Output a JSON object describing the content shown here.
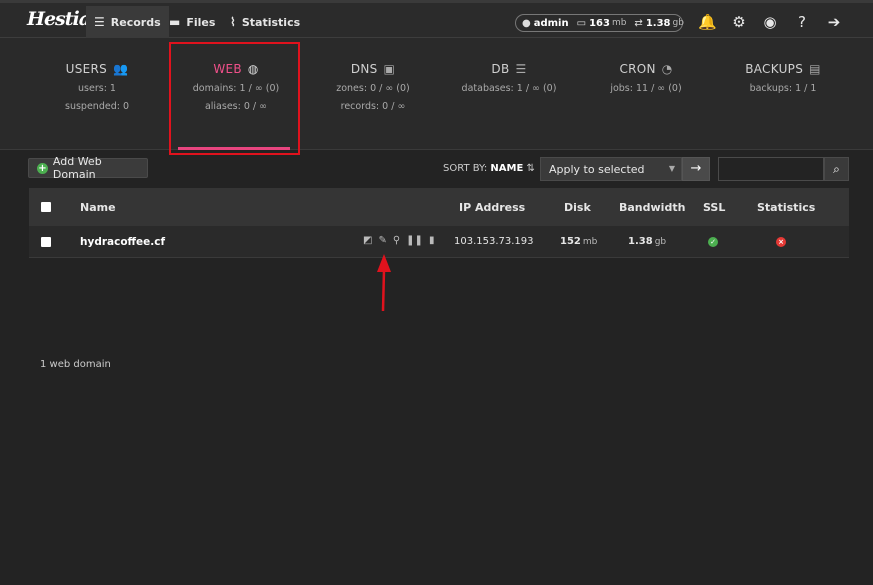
{
  "header": {
    "logo": "Hestia",
    "nav": [
      {
        "label": "Records",
        "icon": "list-icon"
      },
      {
        "label": "Files",
        "icon": "folder-icon"
      },
      {
        "label": "Statistics",
        "icon": "chart-icon"
      }
    ],
    "user": {
      "name": "admin",
      "disk_value": "163",
      "disk_unit": "mb",
      "bandwidth_value": "1.38",
      "bandwidth_unit": "gb"
    }
  },
  "stats": [
    {
      "key": "users",
      "title": "USERS",
      "icon": "users-icon",
      "lines": [
        "users: 1",
        "suspended: 0"
      ]
    },
    {
      "key": "web",
      "title": "WEB",
      "icon": "globe-icon",
      "lines": [
        "domains: 1 / ∞ (0)",
        "aliases: 0 / ∞"
      ]
    },
    {
      "key": "dns",
      "title": "DNS",
      "icon": "book-icon",
      "lines": [
        "zones: 0 / ∞ (0)",
        "records: 0 / ∞"
      ]
    },
    {
      "key": "db",
      "title": "DB",
      "icon": "database-icon",
      "lines": [
        "databases: 1 / ∞ (0)"
      ]
    },
    {
      "key": "cron",
      "title": "CRON",
      "icon": "clock-icon",
      "lines": [
        "jobs: 11 / ∞ (0)"
      ]
    },
    {
      "key": "backups",
      "title": "BACKUPS",
      "icon": "file-icon",
      "lines": [
        "backups: 1 / 1"
      ]
    }
  ],
  "toolbar": {
    "add_label": "Add Web Domain",
    "sort_by_label": "SORT BY:",
    "sort_field": "NAME",
    "apply_label": "Apply to selected",
    "search_placeholder": ""
  },
  "table": {
    "headers": {
      "name": "Name",
      "ip": "IP Address",
      "disk": "Disk",
      "bandwidth": "Bandwidth",
      "ssl": "SSL",
      "statistics": "Statistics"
    },
    "rows": [
      {
        "name": "hydracoffee.cf",
        "ip": "103.153.73.193",
        "disk_value": "152",
        "disk_unit": "mb",
        "bandwidth_value": "1.38",
        "bandwidth_unit": "gb",
        "ssl": true,
        "statistics": false
      }
    ]
  },
  "footer": {
    "count": "1 web domain"
  },
  "colors": {
    "accent": "#e8457f",
    "highlight": "#e0121d",
    "ok": "#4caf50",
    "bad": "#e53935"
  }
}
